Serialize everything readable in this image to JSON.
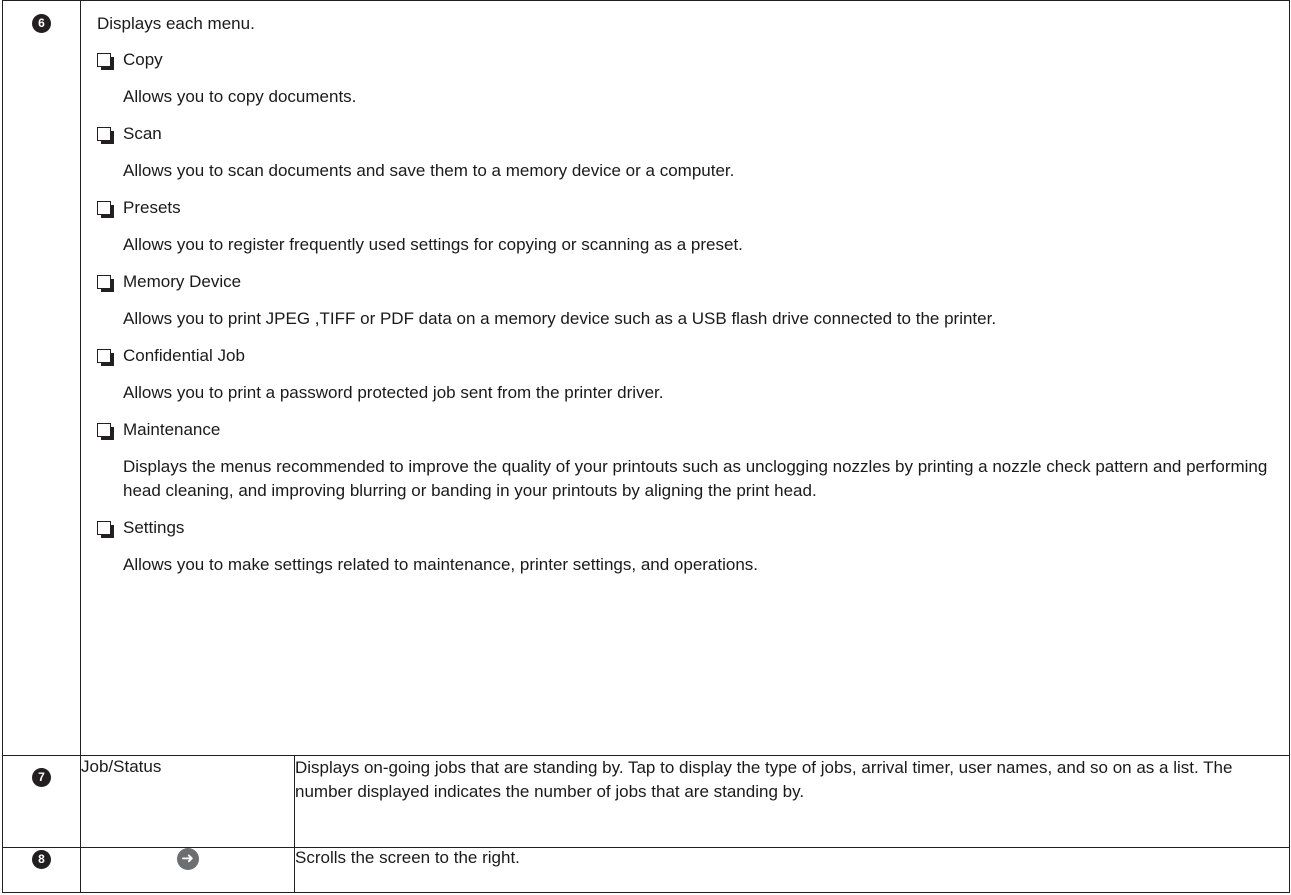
{
  "row6": {
    "badge": "6",
    "intro": "Displays each menu.",
    "items": [
      {
        "title": "Copy",
        "desc": "Allows you to copy documents."
      },
      {
        "title": "Scan",
        "desc": "Allows you to scan documents and save them to a memory device or a computer."
      },
      {
        "title": "Presets",
        "desc": "Allows you to register frequently used settings for copying or scanning as a preset."
      },
      {
        "title": "Memory Device",
        "desc": "Allows you to print JPEG ,TIFF or PDF data on a memory device such as a USB flash drive connected to the printer."
      },
      {
        "title": "Confidential Job",
        "desc": "Allows you to print a password protected job sent from the printer driver."
      },
      {
        "title": "Maintenance",
        "desc": "Displays the menus recommended to improve the quality of your printouts such as unclogging nozzles by printing a nozzle check pattern and performing head cleaning, and improving blurring or banding in your printouts by aligning the print head."
      },
      {
        "title": "Settings",
        "desc": "Allows you to make settings related to maintenance, printer settings, and operations."
      }
    ]
  },
  "row7": {
    "badge": "7",
    "name": "Job/Status",
    "desc": "Displays on-going jobs that are standing by. Tap to display the type of jobs, arrival timer, user names, and so on as a list. The number displayed indicates the number of jobs that are standing by."
  },
  "row8": {
    "badge": "8",
    "icon": "arrow-right-circle-icon",
    "desc": "Scrolls the screen to the right."
  }
}
